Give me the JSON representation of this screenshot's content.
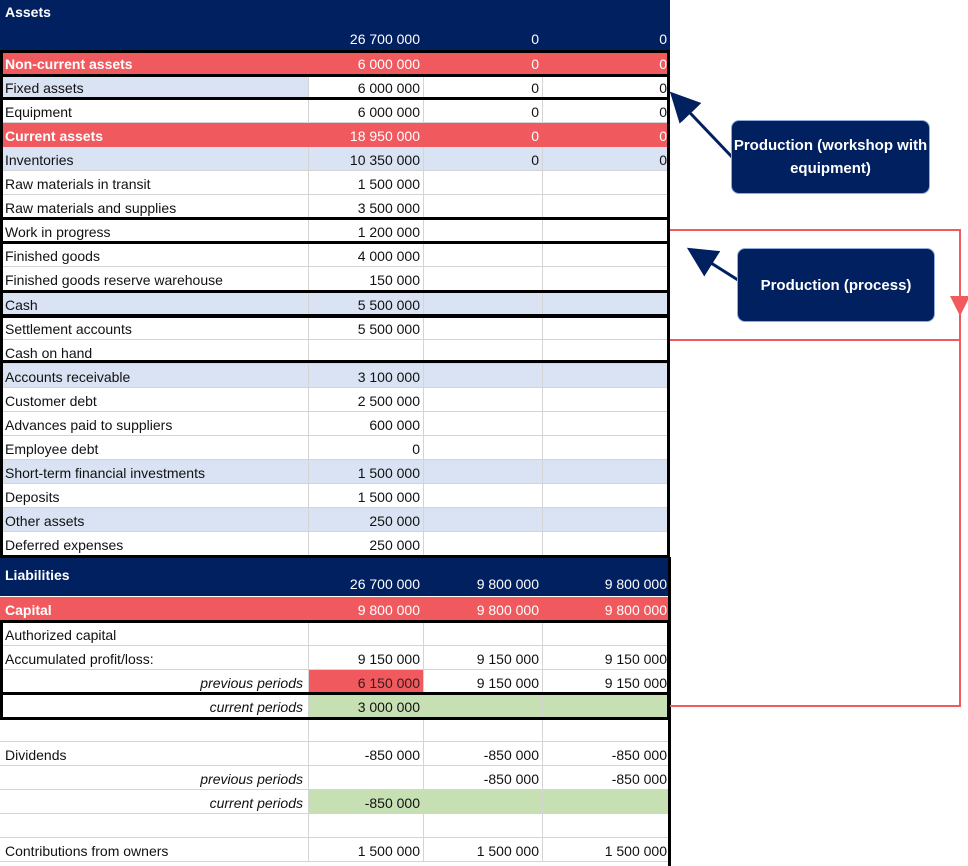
{
  "assets_header": {
    "label": "Assets",
    "v1": "26 700 000",
    "v2": "0",
    "v3": "0"
  },
  "asset_rows": [
    {
      "label": "Non-current assets",
      "v1": "6 000 000",
      "v2": "0",
      "v3": "0"
    },
    {
      "label": "Fixed assets",
      "v1": "6 000 000",
      "v2": "0",
      "v3": "0"
    },
    {
      "label": "Equipment",
      "v1": "6 000 000",
      "v2": "0",
      "v3": "0"
    },
    {
      "label": "Current assets",
      "v1": "18 950 000",
      "v2": "0",
      "v3": "0"
    },
    {
      "label": "Inventories",
      "v1": "10 350 000",
      "v2": "0",
      "v3": "0"
    },
    {
      "label": "Raw materials in transit",
      "v1": "1 500 000",
      "v2": "",
      "v3": ""
    },
    {
      "label": "Raw materials and supplies",
      "v1": "3 500 000",
      "v2": "",
      "v3": ""
    },
    {
      "label": "Work in progress",
      "v1": "1 200 000",
      "v2": "",
      "v3": ""
    },
    {
      "label": "Finished goods",
      "v1": "4 000 000",
      "v2": "",
      "v3": ""
    },
    {
      "label": "Finished goods reserve warehouse",
      "v1": "150 000",
      "v2": "",
      "v3": ""
    },
    {
      "label": "Cash",
      "v1": "5 500 000",
      "v2": "",
      "v3": ""
    },
    {
      "label": "Settlement accounts",
      "v1": "5 500 000",
      "v2": "",
      "v3": ""
    },
    {
      "label": "Cash on hand",
      "v1": "",
      "v2": "",
      "v3": ""
    },
    {
      "label": "Accounts receivable",
      "v1": "3 100 000",
      "v2": "",
      "v3": ""
    },
    {
      "label": "Customer debt",
      "v1": "2 500 000",
      "v2": "",
      "v3": ""
    },
    {
      "label": "Advances paid to suppliers",
      "v1": "600 000",
      "v2": "",
      "v3": ""
    },
    {
      "label": "Employee debt",
      "v1": "0",
      "v2": "",
      "v3": ""
    },
    {
      "label": "Short-term financial investments",
      "v1": "1 500 000",
      "v2": "",
      "v3": ""
    },
    {
      "label": "Deposits",
      "v1": "1 500 000",
      "v2": "",
      "v3": ""
    },
    {
      "label": "Other assets",
      "v1": "250 000",
      "v2": "",
      "v3": ""
    },
    {
      "label": "Deferred expenses",
      "v1": "250 000",
      "v2": "",
      "v3": ""
    }
  ],
  "liabilities_header": {
    "label": "Liabilities",
    "v1": "26 700 000",
    "v2": "9 800 000",
    "v3": "9 800 000"
  },
  "liability_rows": [
    {
      "label": "Capital",
      "v1": "9 800 000",
      "v2": "9 800 000",
      "v3": "9 800 000"
    },
    {
      "label": "Authorized capital",
      "v1": "",
      "v2": "",
      "v3": ""
    },
    {
      "label": "Accumulated profit/loss:",
      "v1": "9 150 000",
      "v2": "9 150 000",
      "v3": "9 150 000"
    },
    {
      "label": "previous periods",
      "v1": "6 150 000",
      "v2": "9 150 000",
      "v3": "9 150 000"
    },
    {
      "label": "current periods",
      "v1": "3 000 000",
      "v2": "",
      "v3": ""
    },
    {
      "label": "",
      "v1": "",
      "v2": "",
      "v3": ""
    },
    {
      "label": "Dividends",
      "v1": "-850 000",
      "v2": "-850 000",
      "v3": "-850 000"
    },
    {
      "label": "previous periods",
      "v1": "",
      "v2": "-850 000",
      "v3": "-850 000"
    },
    {
      "label": "current periods",
      "v1": "-850 000",
      "v2": "",
      "v3": ""
    },
    {
      "label": "",
      "v1": "",
      "v2": "",
      "v3": ""
    },
    {
      "label": "Contributions from owners",
      "v1": "1 500 000",
      "v2": "1 500 000",
      "v3": "1 500 000"
    }
  ],
  "callouts": {
    "workshop": "Production (workshop with equipment)",
    "process": "Production (process)"
  },
  "colors": {
    "header_navy": "#002060",
    "section_red": "#f05a5f",
    "band_blue": "#dae3f3",
    "highlight_green": "#c6e0b4"
  }
}
